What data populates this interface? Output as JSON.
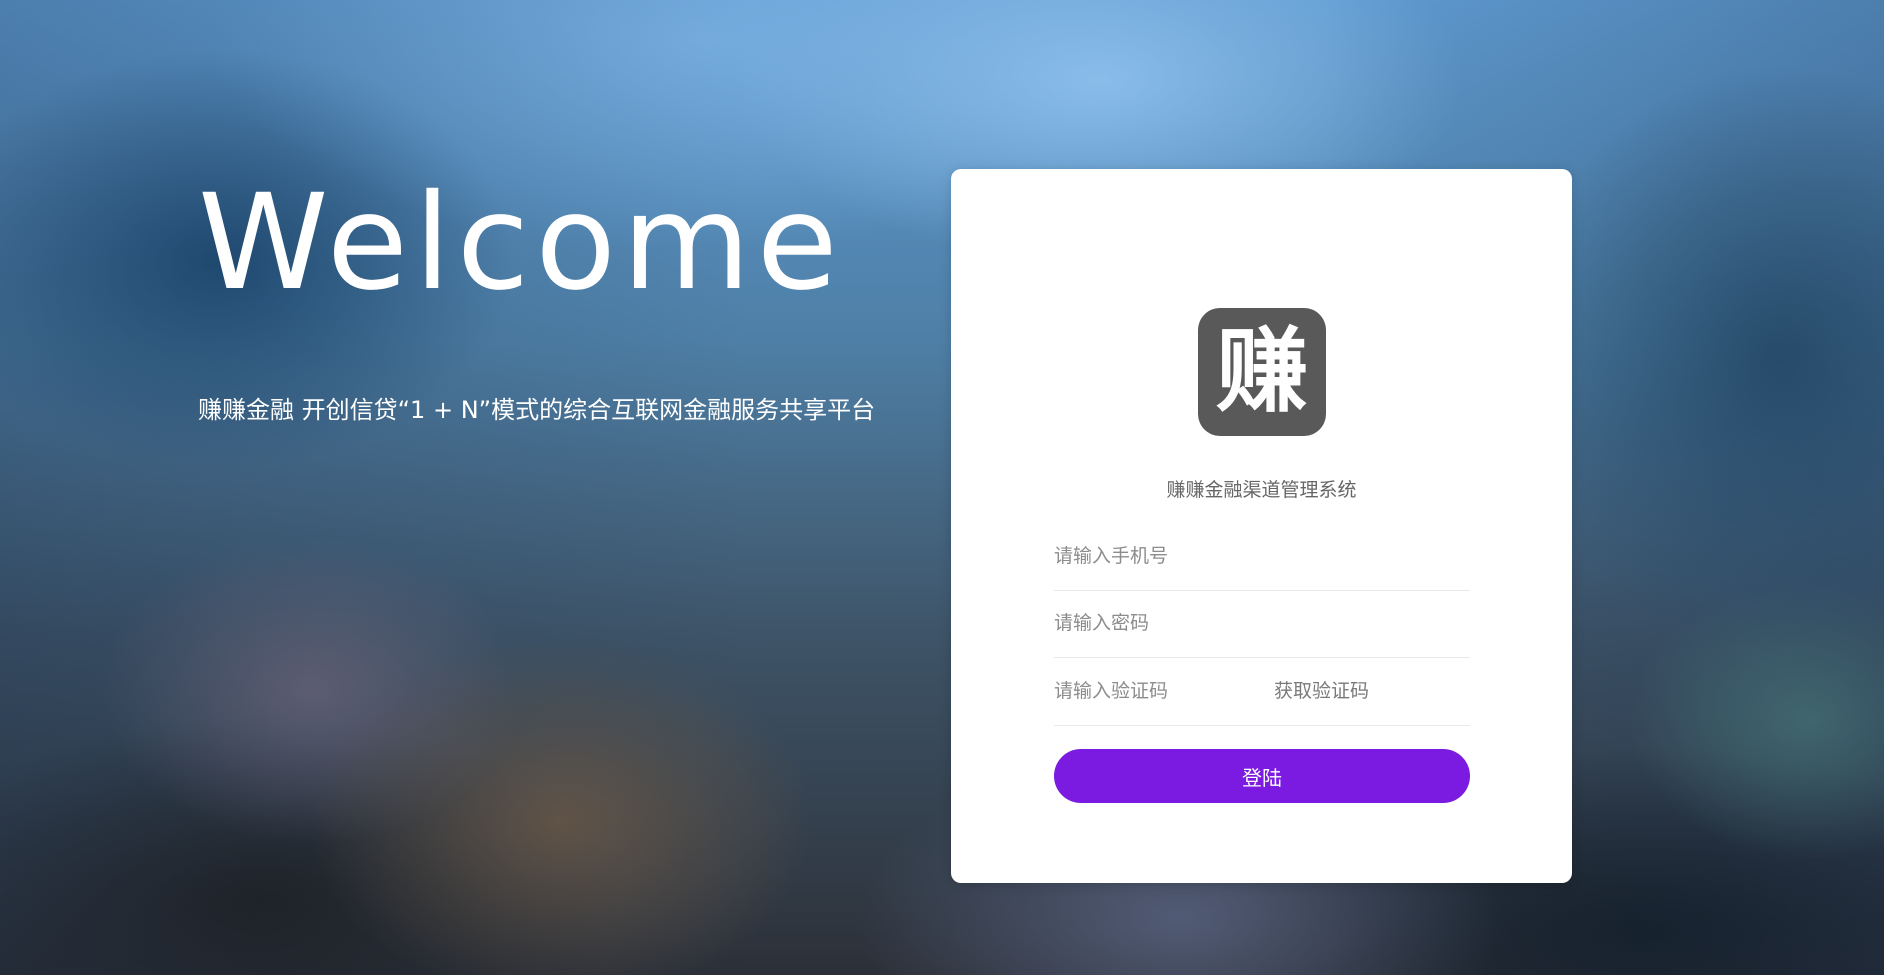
{
  "hero": {
    "title": "Welcome",
    "subtitle": "赚赚金融 开创信贷“1 + N”模式的综合互联网金融服务共享平台"
  },
  "login": {
    "logo_char": "赚",
    "system_name": "赚赚金融渠道管理系统",
    "phone_placeholder": "请输入手机号",
    "password_placeholder": "请输入密码",
    "code_placeholder": "请输入验证码",
    "get_code_label": "获取验证码",
    "submit_label": "登陆"
  },
  "colors": {
    "primary_button": "#7b1ae0",
    "logo_background": "#595959"
  }
}
